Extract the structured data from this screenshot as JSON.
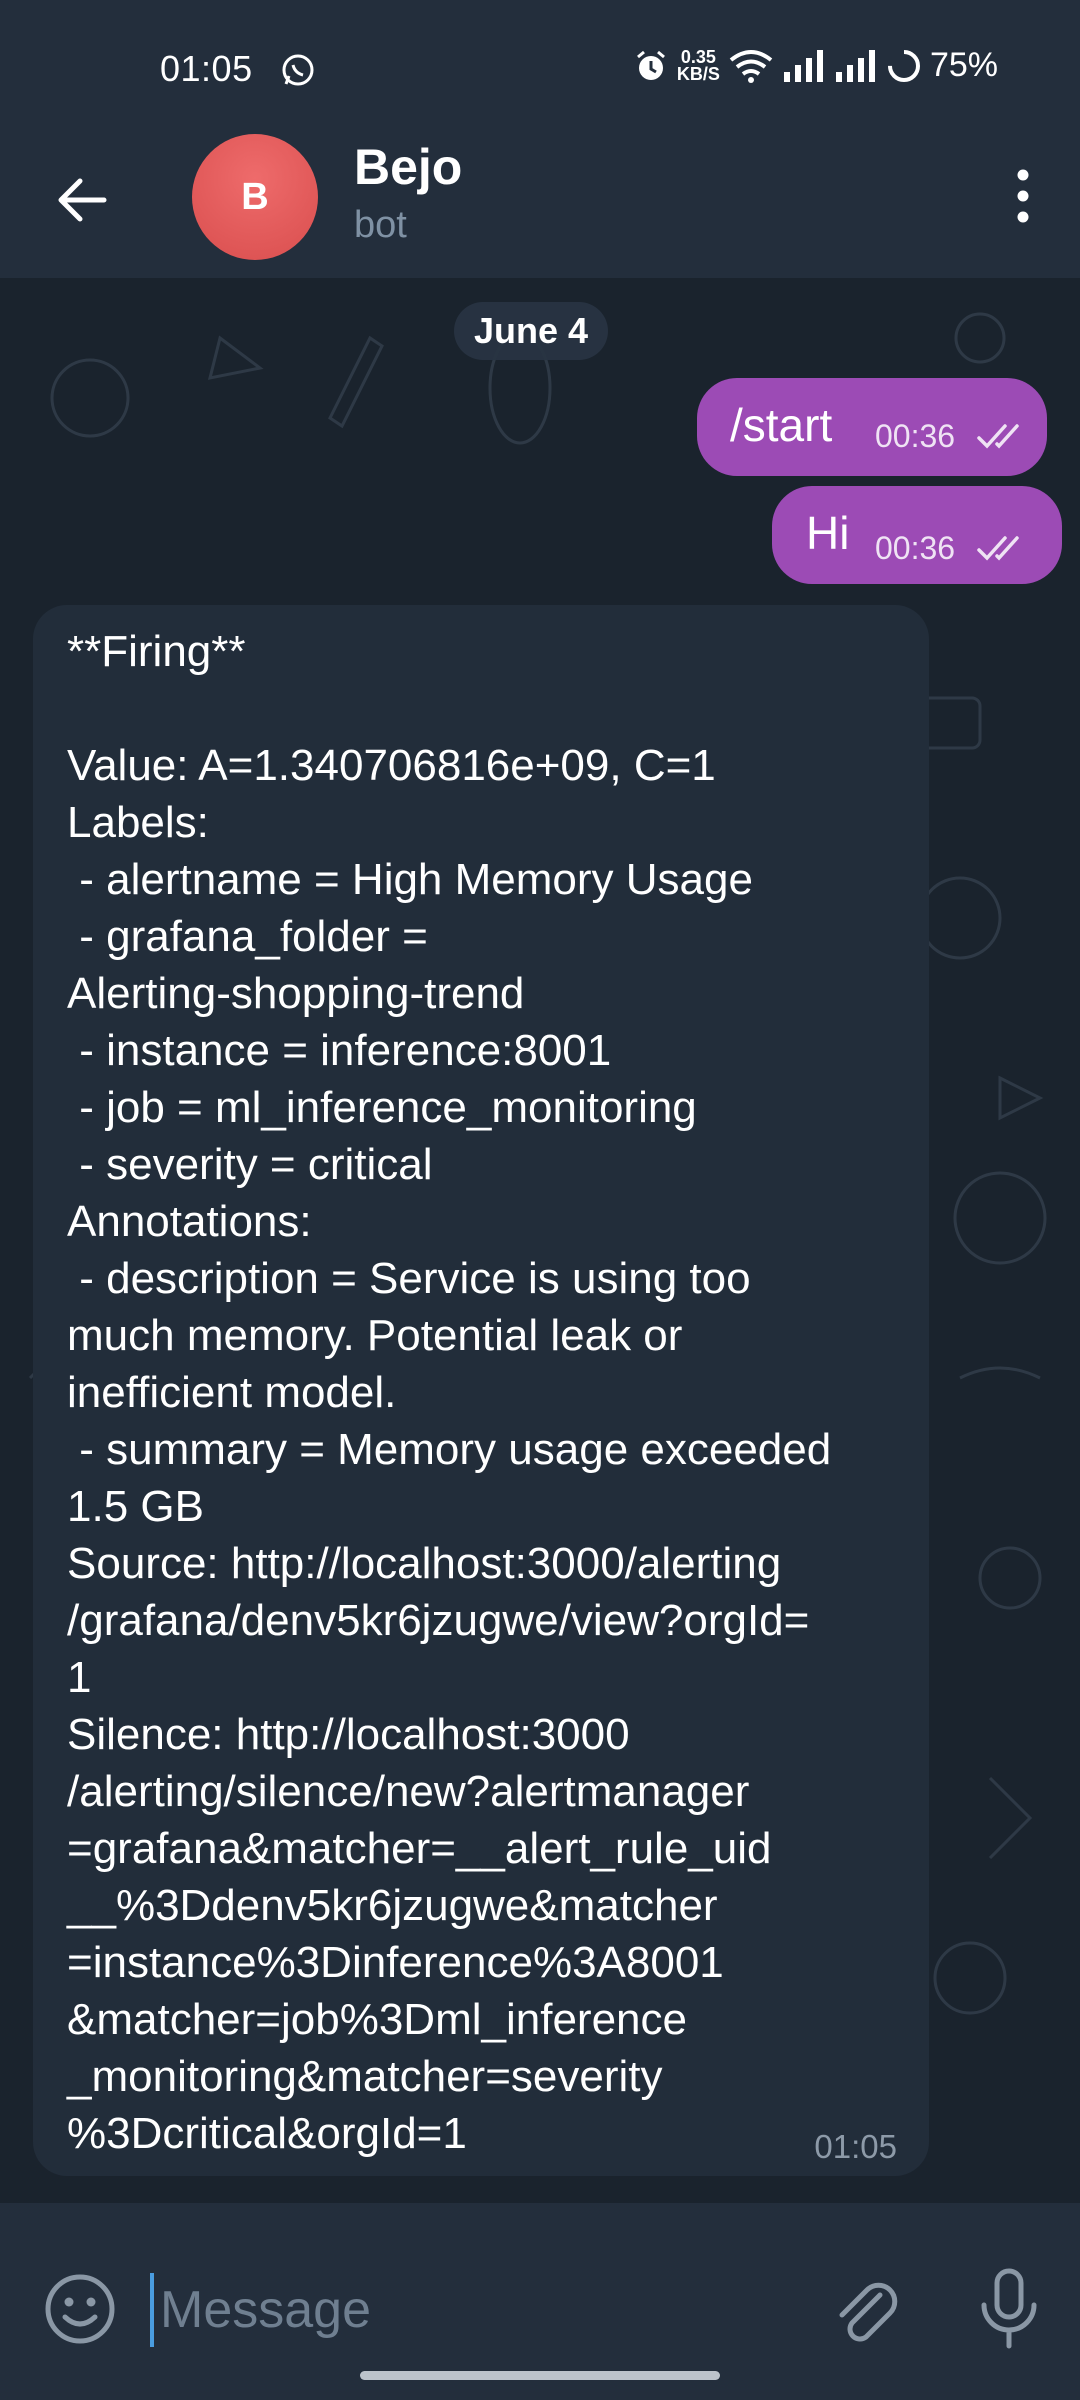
{
  "status_bar": {
    "time": "01:05",
    "net_speed_value": "0.35",
    "net_speed_unit": "KB/S",
    "battery": "75%"
  },
  "header": {
    "avatar_letter": "B",
    "name": "Bejo",
    "status": "bot"
  },
  "chat": {
    "date": "June 4",
    "outgoing": [
      {
        "text": "/start",
        "time": "00:36"
      },
      {
        "text": "Hi",
        "time": "00:36"
      }
    ],
    "incoming": {
      "text": "**Firing**\n\nValue: A=1.340706816e+09, C=1\nLabels:\n - alertname = High Memory Usage\n - grafana_folder =\nAlerting-shopping-trend\n - instance = inference:8001\n - job = ml_inference_monitoring\n - severity = critical\nAnnotations:\n - description = Service is using too\nmuch memory. Potential leak or\ninefficient model.\n - summary = Memory usage exceeded\n1.5 GB\nSource: http://localhost:3000/alerting\n/grafana/denv5kr6jzugwe/view?orgId=\n1\nSilence: http://localhost:3000\n/alerting/silence/new?alertmanager\n=grafana&matcher=__alert_rule_uid\n__%3Ddenv5kr6jzugwe&matcher\n=instance%3Dinference%3A8001\n&matcher=job%3Dml_inference\n_monitoring&matcher=severity\n%3Dcritical&orgId=1",
      "time": "01:05"
    }
  },
  "composer": {
    "placeholder": "Message"
  },
  "colors": {
    "outgoing_bubble": "#9c4bb5",
    "incoming_bubble": "#222d3a",
    "avatar": "#e05a5a"
  },
  "icons": [
    "back-arrow-icon",
    "more-vert-icon",
    "whatsapp-icon",
    "alarm-icon",
    "wifi-icon",
    "signal-icon",
    "battery-icon",
    "double-check-icon",
    "emoji-icon",
    "attach-icon",
    "mic-icon"
  ]
}
